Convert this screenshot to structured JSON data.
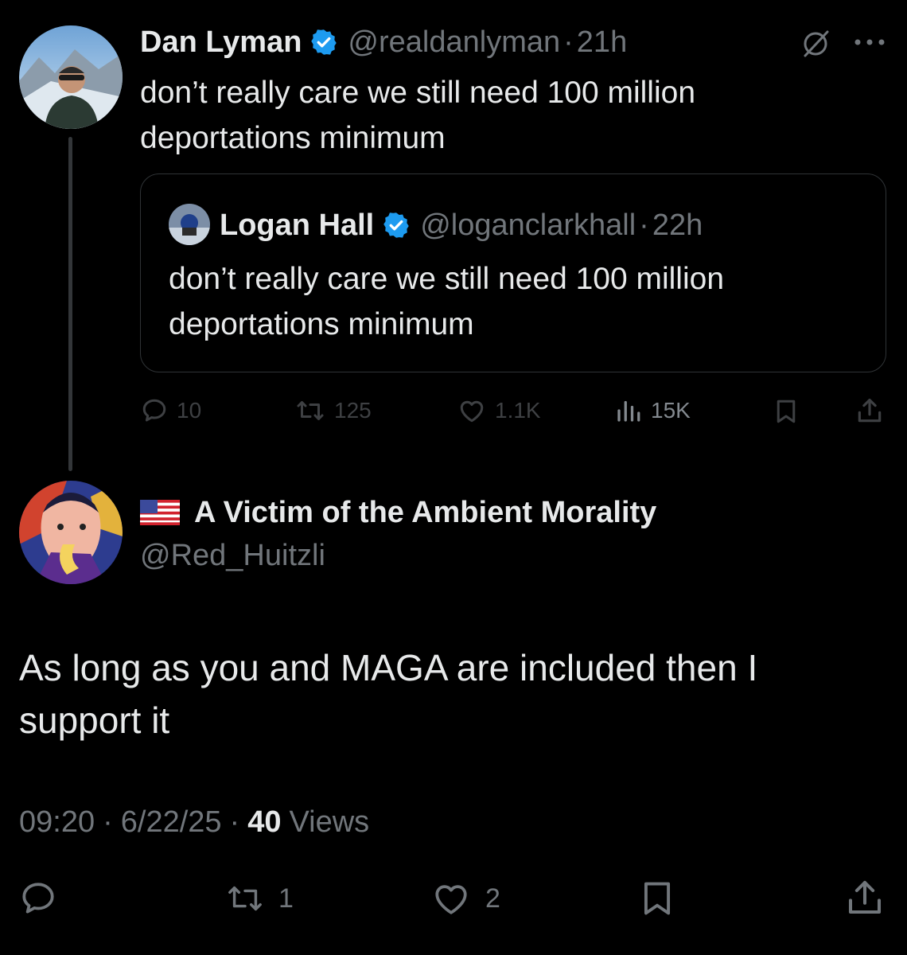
{
  "parent_tweet": {
    "author_name": "Dan Lyman",
    "handle": "@realdanlyman",
    "separator": "·",
    "time": "21h",
    "text_line1": "don’t really care we still need 100 million",
    "text_line2": "deportations minimum",
    "quoted": {
      "author_name": "Logan Hall",
      "handle": "@loganclarkhall",
      "separator": "·",
      "time": "22h",
      "text_line1": "don’t really care we still need 100 million",
      "text_line2": "deportations minimum"
    },
    "actions": {
      "replies": "10",
      "reposts": "125",
      "likes": "1.1K",
      "views": "15K"
    }
  },
  "reply_tweet": {
    "flag": "🇺🇸",
    "author_name": "A Victim of the Ambient Morality",
    "handle": "@Red_Huitzli",
    "text_line1": "As long as you and MAGA are included then I",
    "text_line2": "support it",
    "time": "09:20",
    "separator": "·",
    "date": "6/22/25",
    "views_count": "40",
    "views_label": "Views",
    "actions": {
      "reposts": "1",
      "likes": "2"
    }
  },
  "colors": {
    "background": "#000000",
    "text": "#e7e9ea",
    "muted": "#71767b",
    "verified": "#1d9bf0",
    "border": "#2f3336"
  },
  "icons": [
    "verified-badge-icon",
    "grok-icon",
    "more-icon",
    "reply-icon",
    "repost-icon",
    "like-icon",
    "views-icon",
    "bookmark-icon",
    "share-icon"
  ]
}
